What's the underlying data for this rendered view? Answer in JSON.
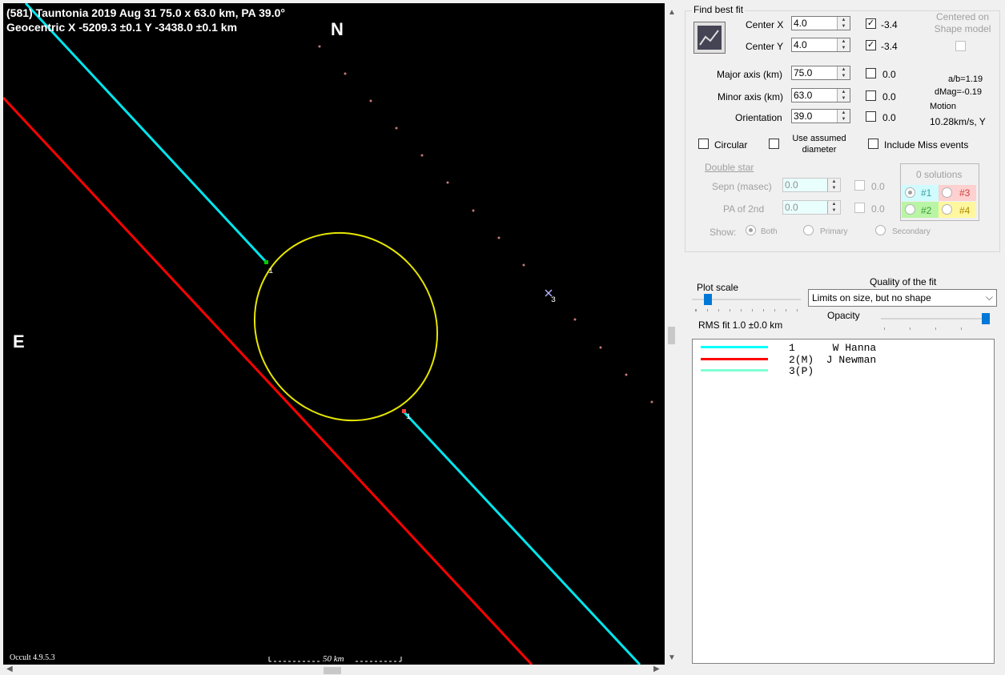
{
  "plot": {
    "title_line1": "(581) Tauntonia  2019 Aug 31   75.0 x 63.0 km, PA 39.0°",
    "title_line2": "Geocentric  X  -5209.3 ±0.1  Y -3438.0 ±0.1 km",
    "north_label": "N",
    "east_label": "E",
    "version": "Occult 4.9.5.3",
    "scale_label": "50 km",
    "chord_labels": [
      "1",
      "1",
      "3"
    ]
  },
  "panel": {
    "find_best_fit": "Find best fit",
    "center_x_label": "Center X",
    "center_x_value": "4.0",
    "center_x_check": "-3.4",
    "center_y_label": "Center Y",
    "center_y_value": "4.0",
    "center_y_check": "-3.4",
    "centered_on_shape": "Centered on Shape model",
    "major_label": "Major axis (km)",
    "major_value": "75.0",
    "major_check": "0.0",
    "minor_label": "Minor axis (km)",
    "minor_value": "63.0",
    "minor_check": "0.0",
    "orient_label": "Orientation",
    "orient_value": "39.0",
    "orient_check": "0.0",
    "ab": "a/b=1.19",
    "dmag": "dMag=-0.19",
    "motion": "Motion",
    "motion_value": "10.28km/s, Y",
    "circular": "Circular",
    "use_assumed": "Use assumed diameter",
    "include_miss": "Include Miss events",
    "double_star": "Double star",
    "sepn_label": "Sepn (masec)",
    "sepn_value": "0.0",
    "sepn_check": "0.0",
    "pa2_label": "PA of 2nd",
    "pa2_value": "0.0",
    "pa2_check": "0.0",
    "solutions": "0 solutions",
    "sol1": "#1",
    "sol2": "#2",
    "sol3": "#3",
    "sol4": "#4",
    "show_label": "Show:",
    "show_both": "Both",
    "show_primary": "Primary",
    "show_secondary": "Secondary",
    "plot_scale": "Plot scale",
    "quality_label": "Quality of the fit",
    "quality_value": "Limits on size, but no shape",
    "opacity": "Opacity",
    "rms": "RMS fit  1.0 ±0.0 km",
    "plot_scale_level": 0.12,
    "opacity_level": 1.0
  },
  "legend": [
    {
      "num": "1      W Hanna",
      "color": "#00ffff"
    },
    {
      "num": "2(M)  J Newman",
      "color": "#ff0000"
    },
    {
      "num": "3(P)",
      "color": "#7fffd4"
    }
  ],
  "colors": {
    "chord1": "#00e5ee",
    "chord2": "#ff0000",
    "ellipse": "#e6e600",
    "dots": "#c87878",
    "sol1_bg": "#d0fbff",
    "sol2_bg": "#b9f5a5",
    "sol3_bg": "#ffd0d0",
    "sol4_bg": "#fff7a0"
  }
}
